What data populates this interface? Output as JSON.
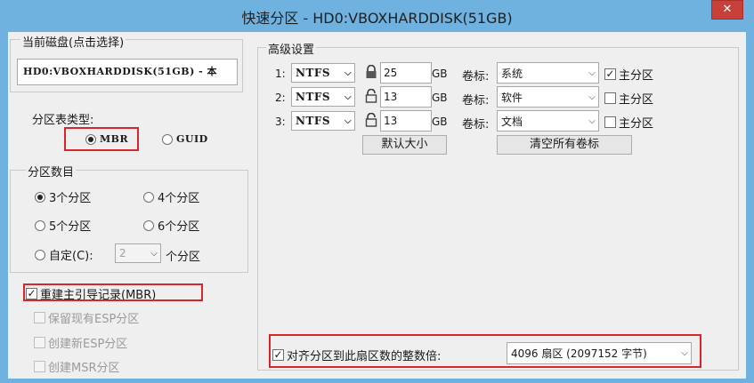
{
  "window": {
    "title": "快速分区 - HD0:VBOXHARDDISK(51GB)",
    "close_glyph": "✕"
  },
  "current_disk": {
    "label": "当前磁盘(点击选择)",
    "value": "HD0:VBOXHARDDISK(51GB) - 本"
  },
  "partition_table": {
    "label": "分区表类型:",
    "options": [
      "MBR",
      "GUID"
    ],
    "selected": "MBR"
  },
  "partition_count": {
    "label": "分区数目",
    "options": [
      "3个分区",
      "4个分区",
      "5个分区",
      "6个分区"
    ],
    "selected": "3个分区",
    "custom_label": "自定(C):",
    "custom_value": "2",
    "custom_suffix": "个分区"
  },
  "options": {
    "rebuild_mbr": "重建主引导记录(MBR)",
    "keep_esp": "保留现有ESP分区",
    "create_esp": "创建新ESP分区",
    "create_msr": "创建MSR分区"
  },
  "advanced": {
    "label": "高级设置",
    "unit": "GB",
    "volume_label_caption": "卷标:",
    "primary_label": "主分区",
    "rows": [
      {
        "index": "1:",
        "fs": "NTFS",
        "size": "25",
        "volume": "系统",
        "primary": true,
        "locked": true
      },
      {
        "index": "2:",
        "fs": "NTFS",
        "size": "13",
        "volume": "软件",
        "primary": false,
        "locked": false
      },
      {
        "index": "3:",
        "fs": "NTFS",
        "size": "13",
        "volume": "文档",
        "primary": false,
        "locked": false
      }
    ],
    "default_size_button": "默认大小",
    "clear_labels_button": "清空所有卷标"
  },
  "align": {
    "label": "对齐分区到此扇区数的整数倍:",
    "value": "4096 扇区 (2097152 字节)",
    "checked": true
  },
  "colors": {
    "highlight": "#d8262c",
    "title_bar": "#6fb2df",
    "close_button": "#c7413a"
  }
}
